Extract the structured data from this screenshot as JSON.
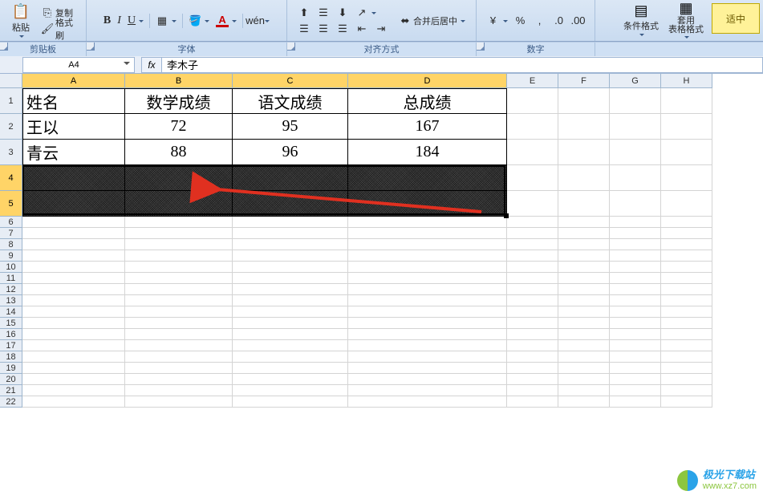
{
  "ribbon": {
    "paste": {
      "label": "粘贴",
      "copy": "复制",
      "format_painter": "格式刷"
    },
    "groups": {
      "clipboard": "剪贴板",
      "font": "字体",
      "alignment": "对齐方式",
      "number": "数字"
    },
    "font_btns": {
      "bold": "B",
      "italic": "I",
      "underline": "U"
    },
    "merge_label": "合并后居中",
    "cond_format": "条件格式",
    "table_format": "套用\n表格格式",
    "style_sample": "适中"
  },
  "namebox": "A4",
  "formula_fx": "fx",
  "formula_value": "李木子",
  "columns": [
    {
      "label": "A",
      "w": 128,
      "sel": true
    },
    {
      "label": "B",
      "w": 134,
      "sel": true
    },
    {
      "label": "C",
      "w": 144,
      "sel": true
    },
    {
      "label": "D",
      "w": 198,
      "sel": true
    },
    {
      "label": "E",
      "w": 64,
      "sel": false
    },
    {
      "label": "F",
      "w": 64,
      "sel": false
    },
    {
      "label": "G",
      "w": 64,
      "sel": false
    },
    {
      "label": "H",
      "w": 64,
      "sel": false
    }
  ],
  "row_heights": {
    "data": 32,
    "small": 14
  },
  "sel_rows": [
    4,
    5
  ],
  "header_row": [
    "姓名",
    "数学成绩",
    "语文成绩",
    "总成绩"
  ],
  "data_rows": [
    {
      "name": "王以",
      "math": "72",
      "chinese": "95",
      "total": "167"
    },
    {
      "name": "青云",
      "math": "88",
      "chinese": "96",
      "total": "184"
    }
  ],
  "chart_data": {
    "type": "table",
    "columns": [
      "姓名",
      "数学成绩",
      "语文成绩",
      "总成绩"
    ],
    "rows": [
      [
        "王以",
        72,
        95,
        167
      ],
      [
        "青云",
        88,
        96,
        184
      ]
    ]
  },
  "watermark": {
    "title": "极光下载站",
    "url": "www.xz7.com"
  },
  "visible_small_rows": [
    6,
    7,
    8,
    9,
    10,
    11,
    12,
    13,
    14,
    15,
    16,
    17,
    18,
    19,
    20,
    21,
    22
  ]
}
